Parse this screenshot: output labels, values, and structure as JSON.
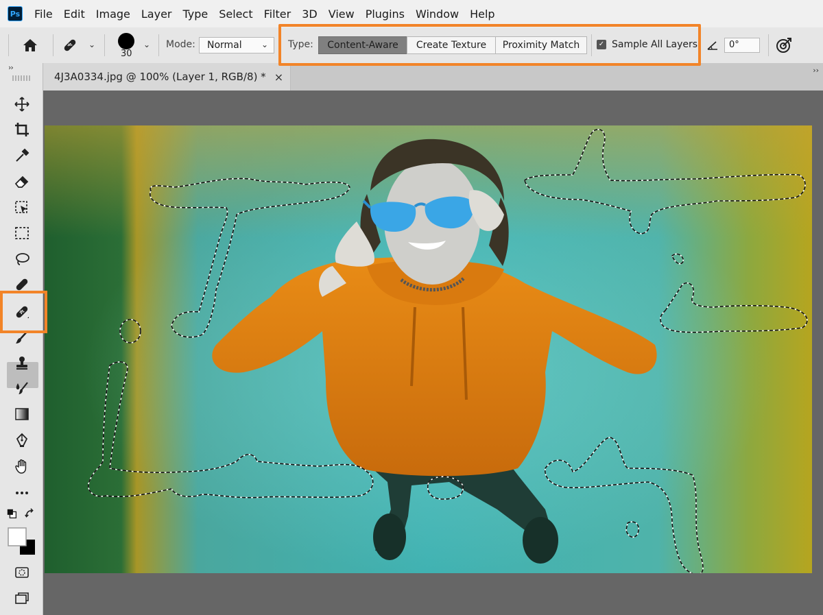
{
  "app": {
    "logo": "Ps"
  },
  "menu": [
    "File",
    "Edit",
    "Image",
    "Layer",
    "Type",
    "Select",
    "Filter",
    "3D",
    "View",
    "Plugins",
    "Window",
    "Help"
  ],
  "options_bar": {
    "brush_size": "30",
    "mode_label": "Mode:",
    "mode_value": "Normal",
    "type_label": "Type:",
    "type_buttons": [
      "Content-Aware",
      "Create Texture",
      "Proximity Match"
    ],
    "active_type": "Content-Aware",
    "sample_all_layers_label": "Sample All Layers",
    "sample_all_layers_checked": true,
    "angle_value": "0°",
    "highlight_color": "#f28428"
  },
  "document": {
    "tab_title": "4J3A0334.jpg @ 100% (Layer 1, RGB/8) *",
    "close_glyph": "×"
  },
  "toolbar": {
    "collapse_glyph": "››",
    "tools": [
      "move-icon",
      "crop-icon",
      "eyedropper-icon",
      "eraser-icon",
      "object-selection-icon",
      "rectangular-marquee-icon",
      "lasso-icon",
      "spot-healing-brush-icon",
      "healing-brush-icon",
      "brush-icon",
      "clone-stamp-icon",
      "blur-icon",
      "gradient-icon",
      "pen-icon",
      "hand-icon",
      "more-tools-icon",
      "default-colors-icon",
      "swap-colors-icon",
      "color-swatches-icon",
      "quick-mask-icon",
      "screen-mode-icon"
    ],
    "active_tool": "healing-brush-icon"
  }
}
